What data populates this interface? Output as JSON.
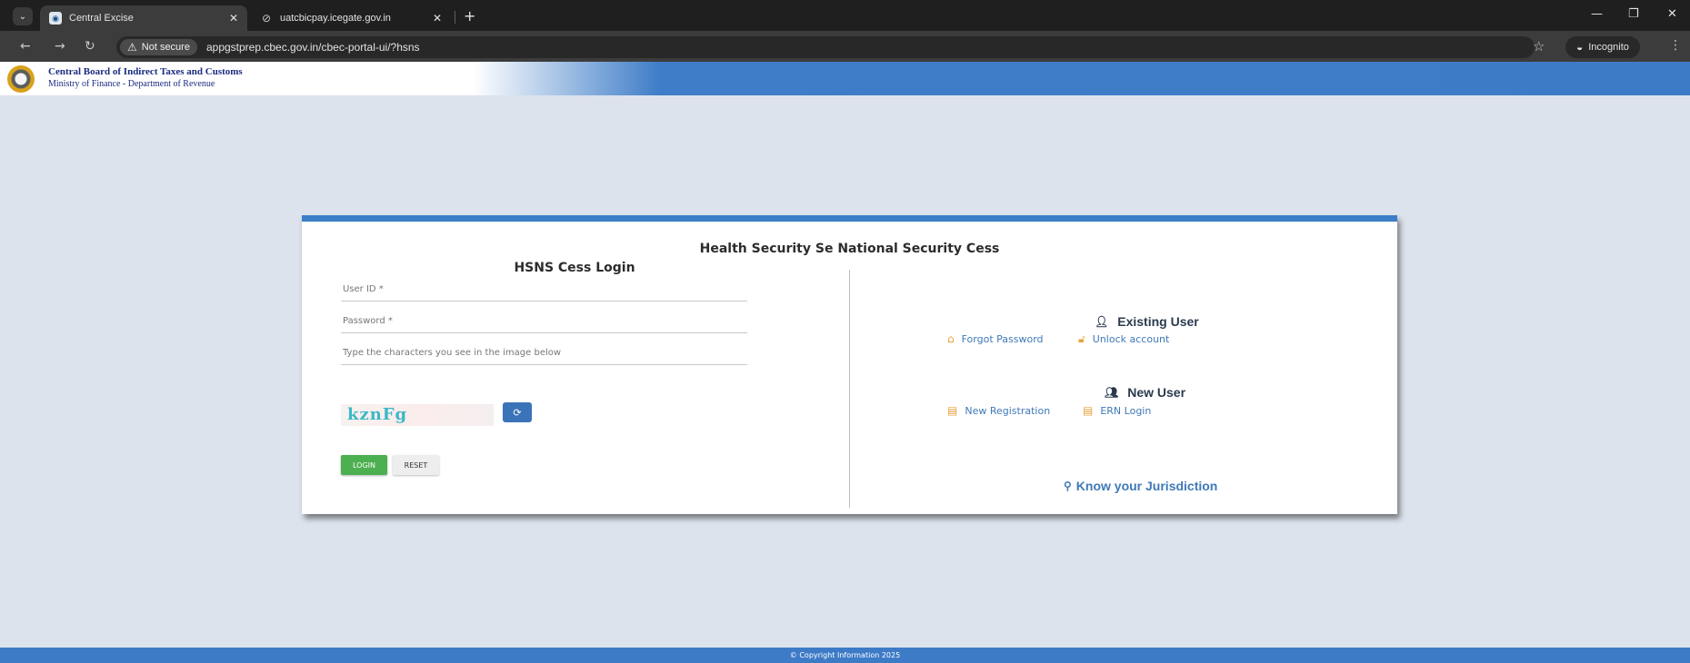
{
  "browser": {
    "tabs": [
      {
        "title": "Central Excise",
        "active": true
      },
      {
        "title": "uatcbicpay.icegate.gov.in",
        "active": false
      }
    ],
    "security_label": "Not secure",
    "url": "appgstprep.cbec.gov.in/cbec-portal-ui/?hsns",
    "profile_label": "Incognito"
  },
  "header": {
    "org_name": "Central Board of Indirect Taxes and Customs",
    "org_sub": "Ministry of Finance - Department of Revenue"
  },
  "panel": {
    "title": "Health Security Se National Security Cess",
    "login": {
      "title": "HSNS Cess Login",
      "user_id_placeholder": "User ID *",
      "password_placeholder": "Password *",
      "captcha_placeholder": "Type the characters you see in the image below",
      "captcha_text": "kznFg",
      "login_label": "LOGIN",
      "reset_label": "RESET"
    },
    "existing_user": {
      "title": "Existing User",
      "forgot_password": "Forgot Password",
      "unlock_account": "Unlock account"
    },
    "new_user": {
      "title": "New User",
      "new_registration": "New Registration",
      "ern_login": "ERN Login"
    },
    "jurisdiction": "Know your Jurisdiction"
  },
  "footer": {
    "copyright": "© Copyright Information 2025"
  },
  "colors": {
    "accent": "#3e7bc7",
    "login_button": "#4caf50",
    "link": "#3f79b8",
    "icon_orange": "#e6a23c"
  },
  "icons": [
    "tab-search-icon",
    "favicon-icon",
    "globe-icon",
    "close-icon",
    "plus-icon",
    "minimize-icon",
    "restore-icon",
    "back-icon",
    "forward-icon",
    "reload-icon",
    "warning-icon",
    "star-icon",
    "incognito-icon",
    "kebab-icon",
    "emblem-icon",
    "refresh-icon",
    "user-icon",
    "user-plus-icon",
    "lock-icon",
    "unlock-icon",
    "document-icon",
    "map-marker-icon"
  ]
}
